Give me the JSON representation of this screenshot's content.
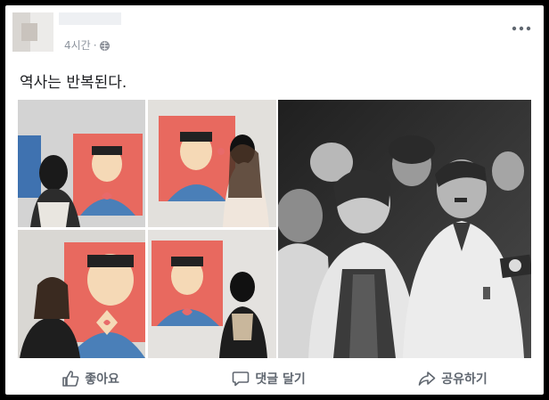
{
  "post": {
    "time": "4시간",
    "separator": "·",
    "caption": "역사는 반복된다."
  },
  "actions": {
    "like": "좋아요",
    "comment": "댓글 달기",
    "share": "공유하기"
  },
  "colors": {
    "background": "#000000",
    "card": "#ffffff",
    "meta_text": "#8d949e",
    "action_text": "#606770",
    "poster_red": "#e8695f",
    "poster_blue": "#4a7fb8"
  },
  "icons": {
    "privacy": "globe-icon",
    "more": "more-options-icon",
    "like": "thumbs-up-icon",
    "comment": "comment-bubble-icon",
    "share": "share-arrow-icon"
  }
}
